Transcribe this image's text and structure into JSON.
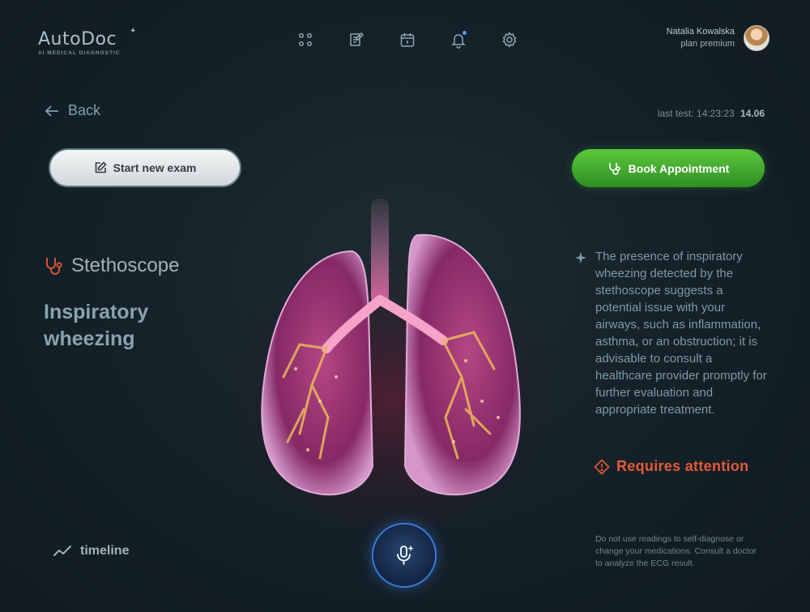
{
  "header": {
    "logo_name": "AutoDoc",
    "logo_sub": "AI MEDICAL DIAGNOSTIC",
    "nav_icons": [
      "grid-icon",
      "notes-icon",
      "calendar-icon",
      "bell-icon",
      "gear-icon"
    ],
    "user": {
      "name": "Natalia Kowalska",
      "plan": "plan premium"
    }
  },
  "back_label": "Back",
  "last_test": {
    "label": "last test:",
    "time": "14:23:23",
    "date": "14.06"
  },
  "buttons": {
    "start_exam": "Start new exam",
    "book_appointment": "Book Appointment"
  },
  "exam": {
    "device": "Stethoscope",
    "finding": "Inspiratory wheezing"
  },
  "description": "The presence of inspiratory wheezing detected by the stethoscope suggests a potential issue with your airways, such as inflammation, asthma, or an obstruction; it is advisable to consult a healthcare provider promptly for further evaluation and appropriate treatment.",
  "status": "Requires attention",
  "timeline_label": "timeline",
  "disclaimer": "Do not use readings to self-diagnose or change your medications. Consult a doctor to analyze the ECG result.",
  "colors": {
    "accent_green": "#3faa2e",
    "warning": "#e45a37",
    "notification": "#46a3ff",
    "mic_glow": "#3a7cd4"
  }
}
